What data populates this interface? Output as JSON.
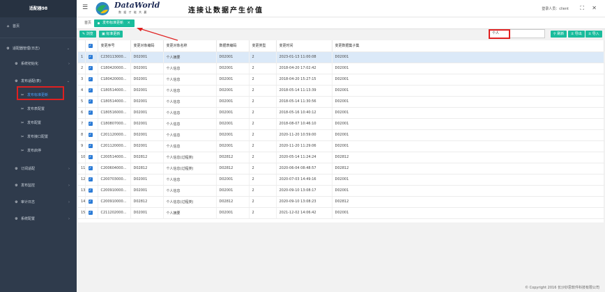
{
  "app": {
    "brand": "适配器98",
    "logo_text": "DataWorld",
    "logo_sub": "数 据 才 能 共 赢",
    "slogan": "连接让数据产生价值",
    "login_label": "登录人员：client"
  },
  "sidebar": {
    "items": [
      {
        "label": "首页",
        "icon": "home-icon"
      },
      {
        "label": "适配器管理(日志)",
        "icon": "gear-icon"
      },
      {
        "label": "系统初始化",
        "icon": "gear-icon"
      },
      {
        "label": "发布适配(表)",
        "icon": "gear-icon"
      },
      {
        "label": "订阅适配",
        "icon": "gear-icon"
      },
      {
        "label": "发布监控",
        "icon": "gear-icon"
      },
      {
        "label": "审计日志",
        "icon": "gear-icon"
      },
      {
        "label": "系统配置",
        "icon": "gear-icon"
      }
    ],
    "sub_items": [
      {
        "label": "发布标准更新",
        "active": true
      },
      {
        "label": "发布表配置"
      },
      {
        "label": "发布配置"
      },
      {
        "label": "发布接口配置"
      },
      {
        "label": "发布启停"
      }
    ]
  },
  "tabs": {
    "home": "首页",
    "active": "发布标准更新",
    "close": "×"
  },
  "toolbar": {
    "browse": "浏览",
    "update": "标准更新",
    "search_value": "个人",
    "refresh": "刷新",
    "export": "导出",
    "import": "导入"
  },
  "table": {
    "headers": [
      "",
      "",
      "变更序号",
      "变更对象编码",
      "变更对象名称",
      "数据表编码",
      "变更类型",
      "变更时间",
      "变更数据集子集"
    ],
    "rows": [
      [
        "1",
        "C230113000...",
        "D02001",
        "个人摘要",
        "D02001",
        "2",
        "2023-01-13 11:00:08",
        "D02001"
      ],
      [
        "2",
        "C180420000...",
        "D02001",
        "个人信息",
        "D02001",
        "2",
        "2018-04-20 17:02:42",
        "D02001"
      ],
      [
        "3",
        "C180420000...",
        "D02001",
        "个人信息",
        "D02001",
        "2",
        "2018-04-20 15:27:15",
        "D02001"
      ],
      [
        "4",
        "C180514000...",
        "D02001",
        "个人信息",
        "D02001",
        "2",
        "2018-05-14 11:13:39",
        "D02001"
      ],
      [
        "5",
        "C180514000...",
        "D02001",
        "个人信息",
        "D02001",
        "2",
        "2018-05-14 11:30:56",
        "D02001"
      ],
      [
        "6",
        "C180516000...",
        "D02001",
        "个人信息",
        "D02001",
        "2",
        "2018-05-16 10:40:12",
        "D02001"
      ],
      [
        "7",
        "C180807000...",
        "D02001",
        "个人信息",
        "D02001",
        "2",
        "2018-08-07 10:46:10",
        "D02001"
      ],
      [
        "8",
        "C201120000...",
        "D02001",
        "个人信息",
        "D02001",
        "2",
        "2020-11-20 10:59:00",
        "D02001"
      ],
      [
        "9",
        "C201120000...",
        "D02001",
        "个人信息",
        "D02001",
        "2",
        "2020-11-20 11:29:06",
        "D02001"
      ],
      [
        "10",
        "C200514000...",
        "D02812",
        "个人信息(过程类)",
        "D02812",
        "2",
        "2020-05-14 11:24:24",
        "D02812"
      ],
      [
        "11",
        "C200604000...",
        "D02812",
        "个人信息(过程类)",
        "D02812",
        "2",
        "2020-06-04 08:48:57",
        "D02812"
      ],
      [
        "12",
        "C200703000...",
        "D02001",
        "个人信息",
        "D02001",
        "2",
        "2020-07-03 14:49:16",
        "D02001"
      ],
      [
        "13",
        "C200910000...",
        "D02001",
        "个人信息",
        "D02001",
        "2",
        "2020-09-10 13:08:17",
        "D02001"
      ],
      [
        "14",
        "C200910000...",
        "D02812",
        "个人信息(过程类)",
        "D02812",
        "2",
        "2020-09-10 13:08:23",
        "D02812"
      ],
      [
        "15",
        "C211202000...",
        "D02001",
        "个人摘要",
        "D02001",
        "2",
        "2021-12-02 14:06:42",
        "D02001"
      ]
    ]
  },
  "footer": "© Copyright 2016 长沙妙思软件科技有限公司",
  "colors": {
    "accent": "#1abc9c",
    "sidebar": "#2f3b4c",
    "highlight": "#e02020",
    "checkbox": "#2b7bd6"
  }
}
